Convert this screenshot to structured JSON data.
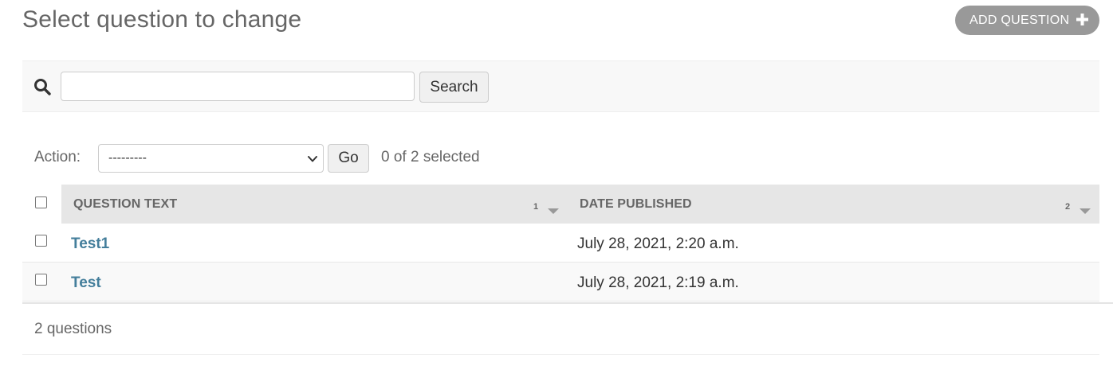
{
  "header": {
    "title": "Select question to change",
    "add_button_label": "ADD QUESTION",
    "add_icon": "plus-icon"
  },
  "search": {
    "icon": "search-icon",
    "value": "",
    "placeholder": "",
    "button_label": "Search"
  },
  "actions": {
    "label": "Action:",
    "selected_option": "---------",
    "go_label": "Go",
    "selection_status": "0 of 2 selected"
  },
  "table": {
    "columns": [
      {
        "label": "QUESTION TEXT",
        "sort_priority": "1",
        "sort_icon": "caret-down-icon"
      },
      {
        "label": "DATE PUBLISHED",
        "sort_priority": "2",
        "sort_icon": "caret-down-icon"
      }
    ],
    "rows": [
      {
        "question_text": "Test1",
        "date_published": "July 28, 2021, 2:20 a.m.",
        "checked": false
      },
      {
        "question_text": "Test",
        "date_published": "July 28, 2021, 2:19 a.m.",
        "checked": false
      }
    ]
  },
  "paginator": {
    "text": "2 questions"
  },
  "colors": {
    "link": "#447e9b",
    "add_button_bg": "#999999",
    "header_bg": "#e6e6e6",
    "search_bar_bg": "#f8f8f8"
  }
}
